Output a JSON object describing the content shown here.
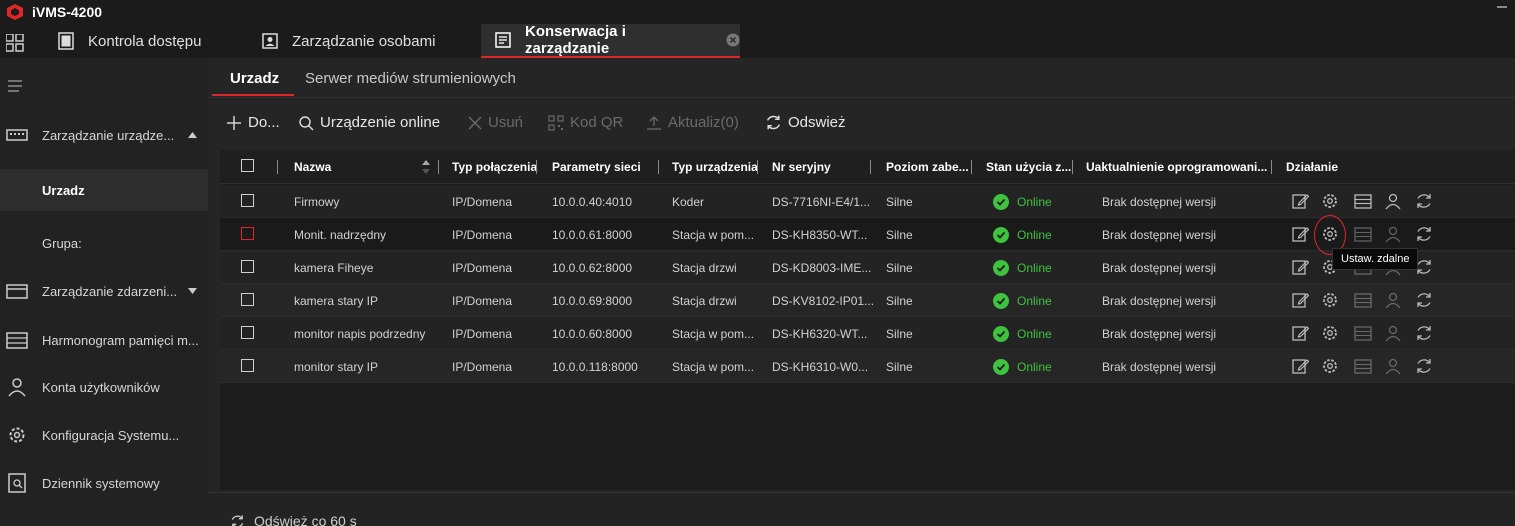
{
  "app": {
    "title": "iVMS-4200"
  },
  "top_tabs": [
    {
      "label": "Kontrola dostępu",
      "icon": "door-icon"
    },
    {
      "label": "Zarządzanie osobami",
      "icon": "person-card-icon"
    },
    {
      "label": "Konserwacja i zarządzanie",
      "icon": "maintenance-icon",
      "active": true
    }
  ],
  "sidebar": {
    "items": [
      {
        "label": "Zarządzanie urządze...",
        "icon": "device-icon"
      },
      {
        "label": "Urzadz"
      },
      {
        "label": "Grupa:"
      },
      {
        "label": "Zarządzanie zdarzeni...",
        "icon": "event-icon"
      },
      {
        "label": "Harmonogram pamięci m...",
        "icon": "storage-icon"
      },
      {
        "label": "Konta użytkowników",
        "icon": "user-icon"
      },
      {
        "label": "Konfiguracja Systemu...",
        "icon": "gear-icon"
      },
      {
        "label": "Dziennik systemowy",
        "icon": "log-icon"
      }
    ]
  },
  "sub_tabs": [
    {
      "label": "Urzadz",
      "active": true
    },
    {
      "label": "Serwer mediów strumieniowych"
    }
  ],
  "toolbar": {
    "add": "Do...",
    "online": "Urządzenie online",
    "delete": "Usuń",
    "qr": "Kod QR",
    "update": "Aktualiz(0)",
    "refresh": "Odswież"
  },
  "table": {
    "headers": [
      "Nazwa",
      "Typ połączenia",
      "Parametry sieci",
      "Typ urządzenia",
      "Nr seryjny",
      "Poziom zabe...",
      "Stan użycia z...",
      "Uaktualnienie oprogramowani...",
      "Działanie"
    ],
    "rows": [
      {
        "name": "Firmowy",
        "conn": "IP/Domena",
        "net": "10.0.0.40:4010",
        "type": "Koder",
        "serial": "DS-7716NI-E4/1...",
        "level": "Silne",
        "status": "Online",
        "update": "Brak dostępnej wersji"
      },
      {
        "name": "Monit. nadrzędny",
        "conn": "IP/Domena",
        "net": "10.0.0.61:8000",
        "type": "Stacja w pom...",
        "serial": "DS-KH8350-WT...",
        "level": "Silne",
        "status": "Online",
        "update": "Brak dostępnej wersji"
      },
      {
        "name": "kamera Fiheye",
        "conn": "IP/Domena",
        "net": "10.0.0.62:8000",
        "type": "Stacja drzwi",
        "serial": "DS-KD8003-IME...",
        "level": "Silne",
        "status": "Online",
        "update": "Brak dostępnej wersji"
      },
      {
        "name": "kamera stary IP",
        "conn": "IP/Domena",
        "net": "10.0.0.69:8000",
        "type": "Stacja drzwi",
        "serial": "DS-KV8102-IP01...",
        "level": "Silne",
        "status": "Online",
        "update": "Brak dostępnej wersji"
      },
      {
        "name": "monitor napis podrzedny",
        "conn": "IP/Domena",
        "net": "10.0.0.60:8000",
        "type": "Stacja w pom...",
        "serial": "DS-KH6320-WT...",
        "level": "Silne",
        "status": "Online",
        "update": "Brak dostępnej wersji"
      },
      {
        "name": "monitor stary IP",
        "conn": "IP/Domena",
        "net": "10.0.0.118:8000",
        "type": "Stacja w pom...",
        "serial": "DS-KH6310-W0...",
        "level": "Silne",
        "status": "Online",
        "update": "Brak dostępnej wersji"
      }
    ]
  },
  "tooltip": "Ustaw. zdalne",
  "footer": {
    "refresh_interval": "Odśwież co 60 s"
  },
  "colors": {
    "accent": "#e0262b",
    "online": "#3fc23f",
    "background": "#1e1e1e"
  }
}
